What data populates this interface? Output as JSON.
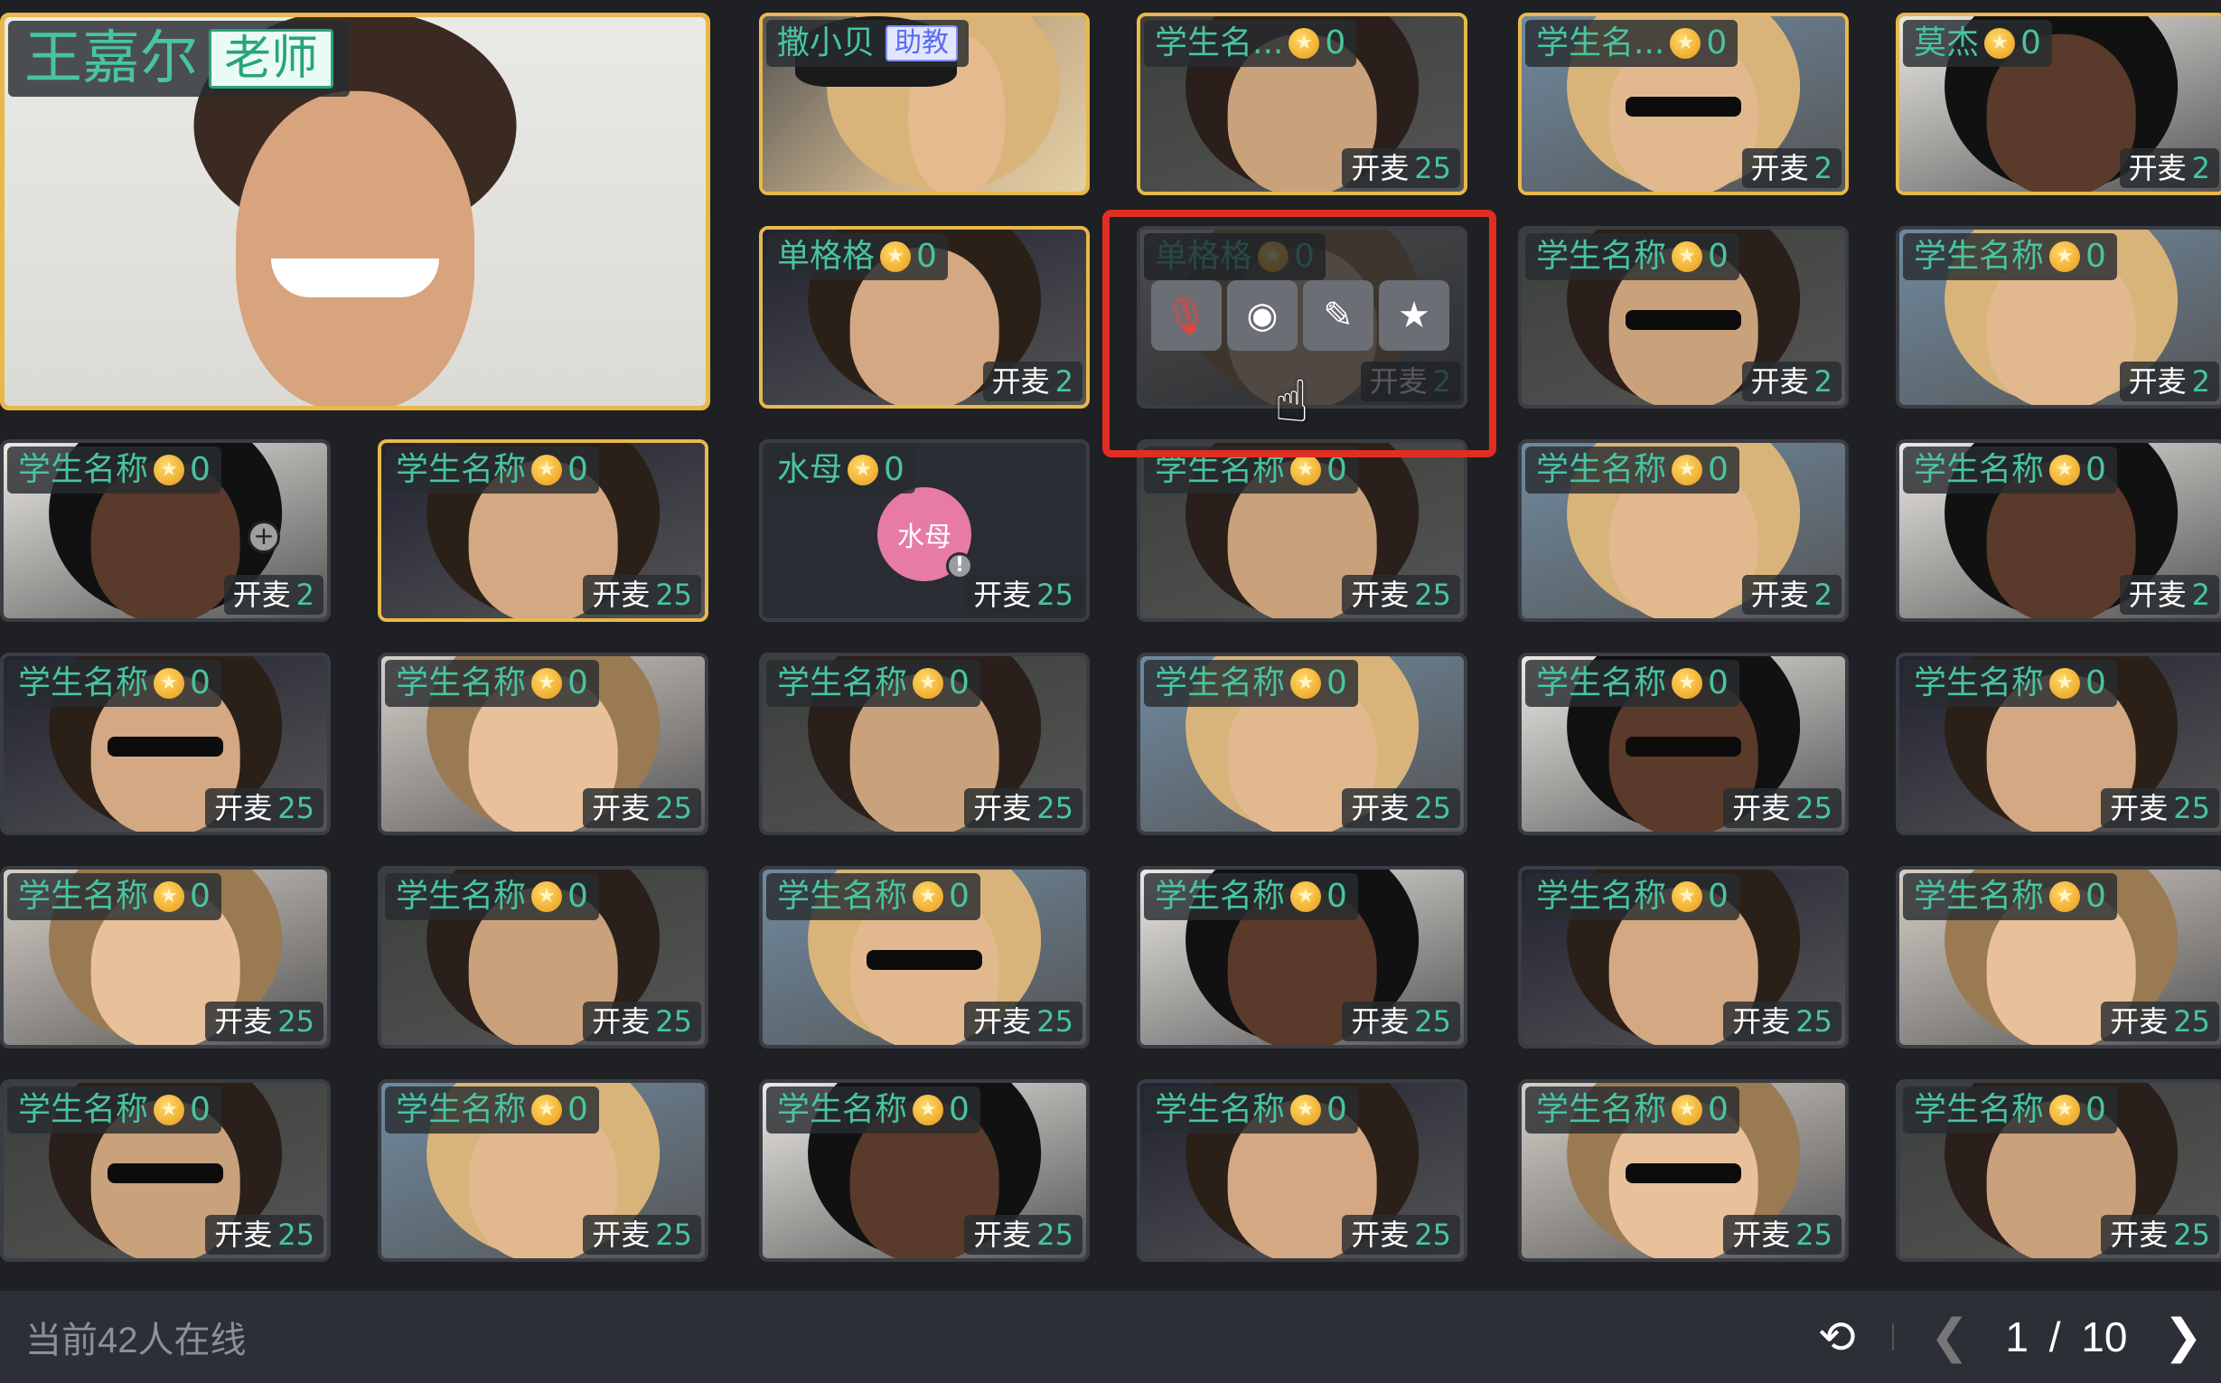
{
  "teacher": {
    "name": "王嘉尔",
    "role": "老师"
  },
  "assistant": {
    "name": "撒小贝",
    "role": "助教"
  },
  "mic_label": "开麦",
  "tiles": [
    {
      "name": "学生名...",
      "score": "0",
      "mic": "25",
      "highlight": true
    },
    {
      "name": "学生名...",
      "score": "0",
      "mic": "2",
      "highlight": true
    },
    {
      "name": "莫杰",
      "score": "0",
      "mic": "2",
      "highlight": true
    },
    {
      "name": "单格格",
      "score": "0",
      "mic": "2",
      "highlight": true
    },
    {
      "name": "单格格",
      "score": "0",
      "mic": "2",
      "highlight": false
    },
    {
      "name": "学生名称",
      "score": "0",
      "mic": "2",
      "highlight": false
    },
    {
      "name": "学生名称",
      "score": "0",
      "mic": "2",
      "highlight": false
    },
    {
      "name": "学生名称",
      "score": "0",
      "mic": "2",
      "highlight": false
    },
    {
      "name": "学生名称",
      "score": "0",
      "mic": "25",
      "highlight": true
    },
    {
      "name": "水母",
      "score": "0",
      "mic": "25",
      "highlight": false,
      "avatar": "水母"
    },
    {
      "name": "学生名称",
      "score": "0",
      "mic": "25",
      "highlight": false
    },
    {
      "name": "学生名称",
      "score": "0",
      "mic": "2",
      "highlight": false
    },
    {
      "name": "学生名称",
      "score": "0",
      "mic": "2",
      "highlight": false
    },
    {
      "name": "学生名称",
      "score": "0",
      "mic": "25",
      "highlight": false
    },
    {
      "name": "学生名称",
      "score": "0",
      "mic": "25",
      "highlight": false
    },
    {
      "name": "学生名称",
      "score": "0",
      "mic": "25",
      "highlight": false
    },
    {
      "name": "学生名称",
      "score": "0",
      "mic": "25",
      "highlight": false
    },
    {
      "name": "学生名称",
      "score": "0",
      "mic": "25",
      "highlight": false
    },
    {
      "name": "学生名称",
      "score": "0",
      "mic": "25",
      "highlight": false
    },
    {
      "name": "学生名称",
      "score": "0",
      "mic": "25",
      "highlight": false
    },
    {
      "name": "学生名称",
      "score": "0",
      "mic": "25",
      "highlight": false
    },
    {
      "name": "学生名称",
      "score": "0",
      "mic": "25",
      "highlight": false
    },
    {
      "name": "学生名称",
      "score": "0",
      "mic": "25",
      "highlight": false
    },
    {
      "name": "学生名称",
      "score": "0",
      "mic": "25",
      "highlight": false
    },
    {
      "name": "学生名称",
      "score": "0",
      "mic": "25",
      "highlight": false
    },
    {
      "name": "学生名称",
      "score": "0",
      "mic": "25",
      "highlight": false
    },
    {
      "name": "学生名称",
      "score": "0",
      "mic": "25",
      "highlight": false
    },
    {
      "name": "学生名称",
      "score": "0",
      "mic": "25",
      "highlight": false
    },
    {
      "name": "学生名称",
      "score": "0",
      "mic": "25",
      "highlight": false
    },
    {
      "name": "学生名称",
      "score": "0",
      "mic": "25",
      "highlight": false
    },
    {
      "name": "学生名称",
      "score": "0",
      "mic": "25",
      "highlight": false
    },
    {
      "name": "学生名称",
      "score": "0",
      "mic": "25",
      "highlight": false
    },
    {
      "name": "学生名称",
      "score": "0",
      "mic": "25",
      "highlight": false
    },
    {
      "name": "学生名称",
      "score": "0",
      "mic": "25",
      "highlight": false
    },
    {
      "name": "学生名称",
      "score": "0",
      "mic": "25",
      "highlight": false
    }
  ],
  "row2_small": {
    "name": "学生名称",
    "score": "0",
    "mic": "2"
  },
  "popover_actions": [
    "mic-off-icon",
    "camera-icon",
    "pencil-icon",
    "star-icon"
  ],
  "footer": {
    "online_text": "当前42人在线",
    "current_page": "1",
    "page_sep": "/",
    "total_pages": "10"
  },
  "colors": {
    "accent_green": "#48c4a0",
    "highlight_gold": "#e8b84a",
    "selection_red": "#e02f22",
    "star": "#f2b22a"
  }
}
